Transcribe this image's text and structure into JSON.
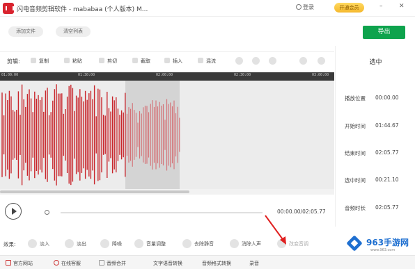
{
  "titlebar": {
    "app_title": "闪电音频剪辑软件 - mababaa (个人版本)  M...",
    "login_label": "登录",
    "vip_label": "开通会员",
    "minimize": "–",
    "close": "✕"
  },
  "top_toolbar": {
    "add_file": "添加文件",
    "clear_list": "清空列表",
    "export": "导出"
  },
  "edit_bar": {
    "label": "剪辑:",
    "tools": [
      "复制",
      "粘贴",
      "剪切",
      "截取",
      "插入",
      "混流"
    ]
  },
  "ruler": {
    "ticks": [
      "01:00:00",
      "01:30:00",
      "02:00:00",
      "02:30:00",
      "03:00:00"
    ]
  },
  "selection": {
    "start_fraction": 0.375,
    "end_fraction": 0.5375
  },
  "side_panel": {
    "title": "选中",
    "rows": [
      {
        "label": "播放位置",
        "value": "00:00.00"
      },
      {
        "label": "开始时间",
        "value": "01:44.67"
      },
      {
        "label": "结束时间",
        "value": "02:05.77"
      },
      {
        "label": "选中时间",
        "value": "00:21.10"
      },
      {
        "label": "音频时长",
        "value": "02:05.77"
      }
    ]
  },
  "player": {
    "time": "00:00.00/02:05.77",
    "progress": 0
  },
  "effects": {
    "label": "效果:",
    "items": [
      "淡入",
      "淡出",
      "降噪",
      "音量调整",
      "去除静音",
      "消除人声",
      "改变音调"
    ]
  },
  "bottom_bar": {
    "items": [
      "官方网站",
      "在线客服",
      "音频合并",
      "文字语音转换",
      "音频格式转换",
      "录音"
    ]
  },
  "watermark": {
    "text": "963手游网",
    "sub": "www.963.com"
  },
  "colors": {
    "wave": "#c9262c",
    "export_green": "#0ea34d",
    "brand_red": "#d9232e"
  }
}
